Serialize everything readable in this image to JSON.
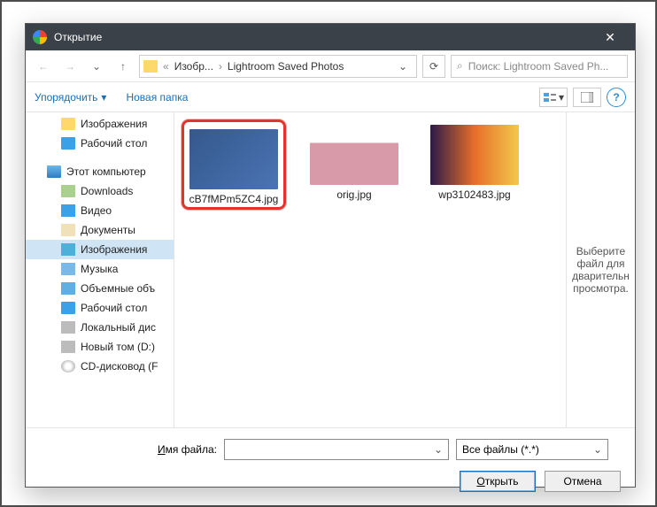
{
  "titlebar": {
    "title": "Открытие",
    "close": "✕"
  },
  "nav": {
    "path_seg1": "Изобр...",
    "path_seg2": "Lightroom Saved Photos",
    "refresh": "⟳",
    "search_placeholder": "Поиск: Lightroom Saved Ph..."
  },
  "toolbar": {
    "organize": "Упорядочить",
    "newfolder": "Новая папка",
    "help": "?"
  },
  "tree": {
    "items": [
      {
        "label": "Изображения",
        "cls": "ico-folder"
      },
      {
        "label": "Рабочий стол",
        "cls": "ico-desktop"
      },
      {
        "label": "Этот компьютер",
        "cls": "ico-pc",
        "root": true
      },
      {
        "label": "Downloads",
        "cls": "ico-dl"
      },
      {
        "label": "Видео",
        "cls": "ico-video"
      },
      {
        "label": "Документы",
        "cls": "ico-doc"
      },
      {
        "label": "Изображения",
        "cls": "ico-img",
        "sel": true
      },
      {
        "label": "Музыка",
        "cls": "ico-music"
      },
      {
        "label": "Объемные объ",
        "cls": "ico-cube"
      },
      {
        "label": "Рабочий стол",
        "cls": "ico-desktop"
      },
      {
        "label": "Локальный дис",
        "cls": "ico-disk"
      },
      {
        "label": "Новый том (D:)",
        "cls": "ico-disk"
      },
      {
        "label": "CD-дисковод (F",
        "cls": "ico-cd"
      }
    ]
  },
  "files": [
    {
      "name": "cB7fMPm5ZC4.jpg",
      "cls": "sel"
    },
    {
      "name": "orig.jpg",
      "cls": "two"
    },
    {
      "name": "wp3102483.jpg",
      "cls": "three"
    }
  ],
  "preview": {
    "text": "Выберите файл для дварительн просмотра."
  },
  "bottom": {
    "filename_label_pre": "",
    "filename_label": "Имя файла:",
    "filename_underline": "И",
    "filename_rest": "мя файла:",
    "filter": "Все файлы (*.*)",
    "open": "Открыть",
    "open_underline": "О",
    "open_rest": "ткрыть",
    "cancel": "Отмена"
  }
}
